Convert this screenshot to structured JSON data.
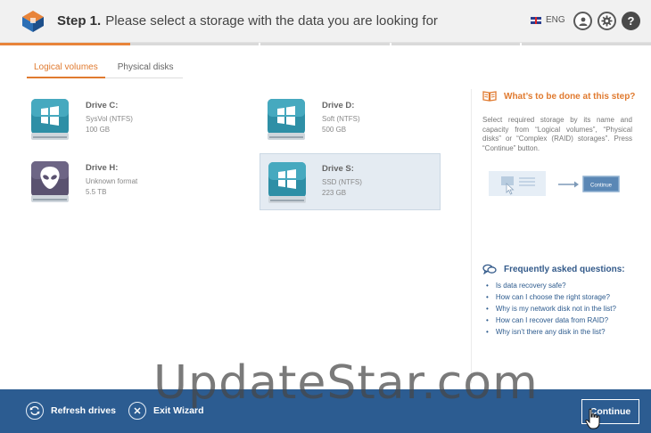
{
  "header": {
    "step_label": "Step 1.",
    "step_text": "Please select a storage with the data you are looking for",
    "language": "ENG",
    "help_glyph": "?"
  },
  "progress": {
    "fraction": 0.2
  },
  "tabs": [
    {
      "label": "Logical volumes",
      "active": true
    },
    {
      "label": "Physical disks",
      "active": false
    }
  ],
  "drives": [
    {
      "name": "Drive C:",
      "fs": "SysVol (NTFS)",
      "size": "100 GB",
      "os_icon": "windows-drive-icon",
      "selected": false
    },
    {
      "name": "Drive D:",
      "fs": "Soft (NTFS)",
      "size": "500 GB",
      "os_icon": "windows-drive-icon",
      "selected": false
    },
    {
      "name": "Drive H:",
      "fs": "Unknown format",
      "size": "5.5 TB",
      "os_icon": "alien-drive-icon",
      "selected": false
    },
    {
      "name": "Drive S:",
      "fs": "SSD (NTFS)",
      "size": "223 GB",
      "os_icon": "windows-drive-icon",
      "selected": true
    }
  ],
  "help": {
    "title": "What’s to be done at this step?",
    "text": "Select required storage by its name and capacity from “Logical volumes”, “Physical disks” or “Complex (RAID) storages”. Press “Continue” button.",
    "illustration_button": "Continue"
  },
  "faq": {
    "title": "Frequently asked questions:",
    "items": [
      "Is data recovery safe?",
      "How can I choose the right storage?",
      "Why is my network disk not in the list?",
      "How can I recover data from RAID?",
      "Why isn’t there any disk in the list?"
    ]
  },
  "footer": {
    "refresh_label": "Refresh drives",
    "exit_label": "Exit Wizard",
    "continue_label": "Continue"
  },
  "watermark": "UpdateStar.com",
  "colors": {
    "accent": "#e07a2f",
    "footer": "#2c5c91",
    "link": "#2d5b8e",
    "selected": "#e4ebf2"
  }
}
